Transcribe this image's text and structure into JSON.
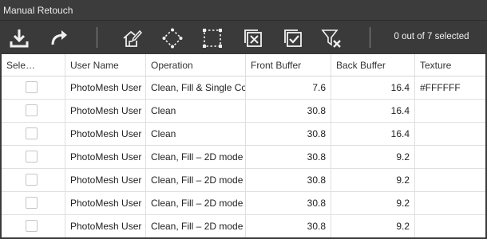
{
  "window": {
    "title": "Manual Retouch"
  },
  "toolbar": {
    "buttons": [
      {
        "name": "import-button",
        "icon": "download-icon"
      },
      {
        "name": "export-button",
        "icon": "share-arrow-icon"
      },
      {
        "name": "edit-button",
        "icon": "house-edit-icon"
      },
      {
        "name": "select-polygon-button",
        "icon": "polygon-select-icon"
      },
      {
        "name": "select-rectangle-button",
        "icon": "rectangle-select-icon"
      },
      {
        "name": "deselect-all-button",
        "icon": "checkbox-x-icon"
      },
      {
        "name": "select-all-button",
        "icon": "checkbox-check-icon"
      },
      {
        "name": "clear-filter-button",
        "icon": "filter-clear-icon"
      }
    ],
    "status": "0 out of 7 selected"
  },
  "table": {
    "columns": [
      "Sele…",
      "User Name",
      "Operation",
      "Front Buffer",
      "Back Buffer",
      "Texture"
    ],
    "rows": [
      {
        "user": "PhotoMesh User",
        "operation": "Clean, Fill & Single Color",
        "front": "7.6",
        "back": "16.4",
        "texture": "#FFFFFF"
      },
      {
        "user": "PhotoMesh User",
        "operation": "Clean",
        "front": "30.8",
        "back": "16.4",
        "texture": ""
      },
      {
        "user": "PhotoMesh User",
        "operation": "Clean",
        "front": "30.8",
        "back": "16.4",
        "texture": ""
      },
      {
        "user": "PhotoMesh User",
        "operation": "Clean, Fill – 2D mode",
        "front": "30.8",
        "back": "9.2",
        "texture": ""
      },
      {
        "user": "PhotoMesh User",
        "operation": "Clean, Fill – 2D mode",
        "front": "30.8",
        "back": "9.2",
        "texture": ""
      },
      {
        "user": "PhotoMesh User",
        "operation": "Clean, Fill – 2D mode",
        "front": "30.8",
        "back": "9.2",
        "texture": ""
      },
      {
        "user": "PhotoMesh User",
        "operation": "Clean, Fill – 2D mode",
        "front": "30.8",
        "back": "9.2",
        "texture": ""
      }
    ]
  },
  "colors": {
    "titlebar": "#3c3c3c",
    "toolbar": "#3a3a3a",
    "grid_bg": "#ffffff",
    "grid_line": "#e0e0e0",
    "icon": "#f0f0f0"
  }
}
